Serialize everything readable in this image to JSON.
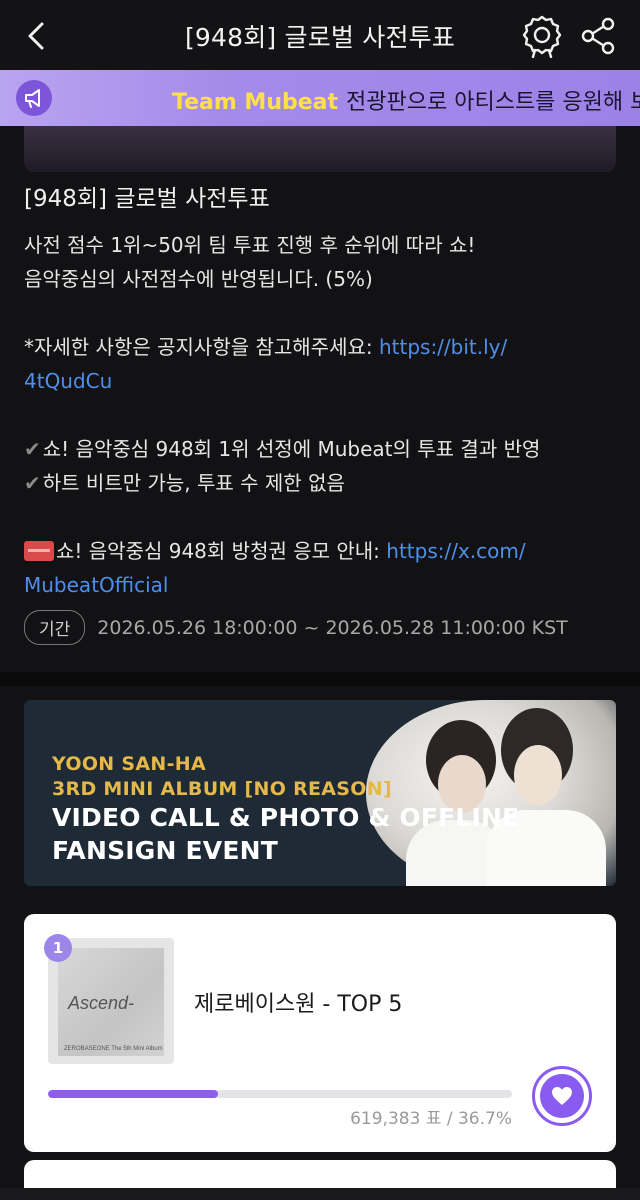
{
  "header": {
    "title": "[948회] 글로벌 사전투표"
  },
  "marquee": {
    "brand": "Team Mubeat",
    "text": "전광판으로 아티스트를 응원해 보"
  },
  "vote": {
    "title": "[948회] 글로벌 사전투표",
    "lines": [
      "사전 점수 1위~50위 팀 투표 진행 후 순위에 따라 쇼!",
      "음악중심의 사전점수에 반영됩니다. (5%)"
    ],
    "notice_text": "*자세한 사항은 공지사항을 참고해주세요: ",
    "notice_link_1": "https://bit.ly/",
    "notice_link_2": "4tQudCu",
    "check_1": "쇼! 음악중심 948회 1위 선정에 Mubeat의 투표 결과 반영",
    "check_2": "하트 비트만 가능, 투표 수 제한 없음",
    "ticket_text": "쇼! 음악중심 948회 방청권 응모 안내: ",
    "ticket_link_1": "https://x.com/",
    "ticket_link_2": "MubeatOfficial",
    "ticket_badge": "ADMIT ONE"
  },
  "period": {
    "label": "기간",
    "range": "2026.05.26 18:00:00 ~ 2026.05.28 11:00:00 KST"
  },
  "ad": {
    "line1": "YOON SAN-HA",
    "line2": "3RD MINI ALBUM [NO REASON]",
    "line3": "VIDEO CALL & PHOTO & OFFLINE",
    "line4": "FANSIGN EVENT"
  },
  "ranking": [
    {
      "rank": "1",
      "album_title": "Ascend-",
      "album_sub": "ZEROBASEONE The 5th Mini Album",
      "song": "제로베이스원 - TOP 5",
      "votes": "619,383 표 / 36.7%",
      "percent": 36.7
    }
  ],
  "colors": {
    "accent": "#8a5bf0",
    "link": "#4f8fe8",
    "marquee_brand": "#ffe04a",
    "ad_gold": "#e4b84a"
  }
}
